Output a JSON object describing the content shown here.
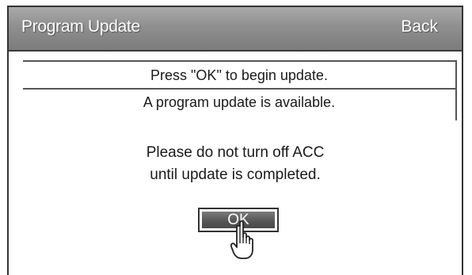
{
  "header": {
    "title": "Program Update",
    "back_label": "Back"
  },
  "rows": [
    {
      "label": "Press \"OK\" to begin update."
    },
    {
      "label": "A program update is available."
    }
  ],
  "message": {
    "line1": "Please do not turn off ACC",
    "line2": "until update is completed."
  },
  "ok_button": {
    "label": "OK"
  },
  "icons": {
    "pointer": "hand-pointer-icon"
  }
}
